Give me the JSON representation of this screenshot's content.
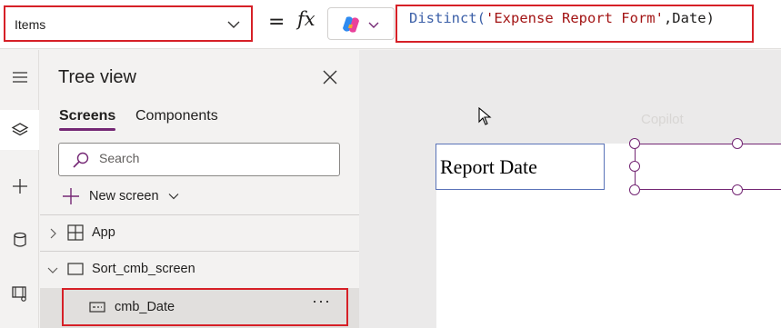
{
  "formula_bar": {
    "property": "Items",
    "equals": "=",
    "fx": "fx",
    "formula": {
      "function": "Distinct(",
      "string": "'Expense Report Form'",
      "rest": ",Date)"
    }
  },
  "rail": {
    "items": [
      {
        "icon": "hamburger-icon"
      },
      {
        "icon": "layers-icon",
        "active": true
      },
      {
        "icon": "plus-icon"
      },
      {
        "icon": "database-icon"
      },
      {
        "icon": "media-icon"
      }
    ]
  },
  "tree_view": {
    "title": "Tree view",
    "tabs": [
      {
        "label": "Screens",
        "active": true
      },
      {
        "label": "Components"
      }
    ],
    "search_placeholder": "Search",
    "new_screen_label": "New screen",
    "nodes": [
      {
        "label": "App",
        "icon": "app-grid-icon",
        "expander": "chevron-right-icon"
      },
      {
        "label": "Sort_cmb_screen",
        "icon": "screen-icon",
        "expander": "chevron-down-icon"
      },
      {
        "label": "cmb_Date",
        "icon": "combobox-icon",
        "selected": true,
        "more": "···"
      }
    ]
  },
  "canvas": {
    "label_text": "Report Date",
    "ghost_toolbar": "Copilot"
  },
  "colors": {
    "highlight": "#d62027",
    "accent": "#742774",
    "function_blue": "#3c60a8",
    "string_red": "#a31515"
  }
}
